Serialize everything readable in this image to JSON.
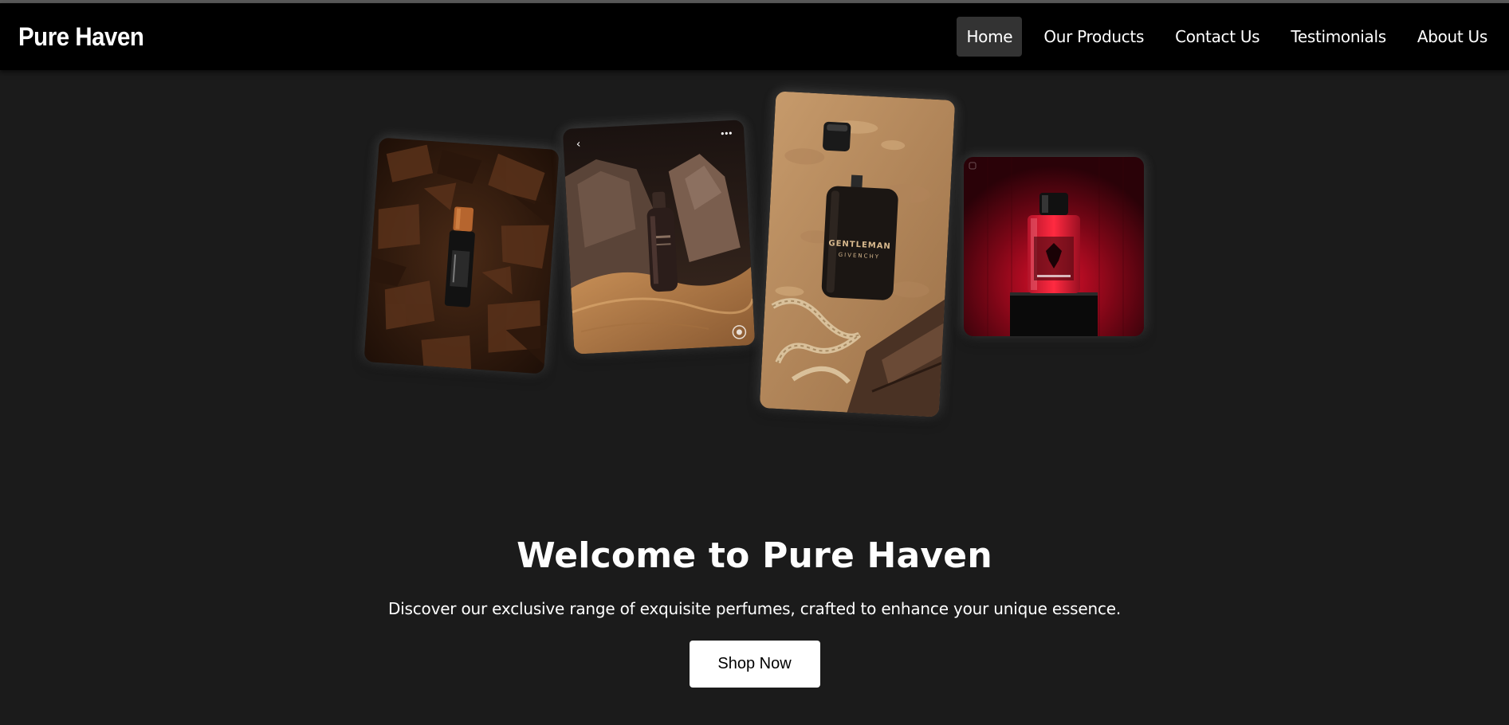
{
  "brand": {
    "name": "Pure Haven"
  },
  "nav": {
    "items": [
      {
        "label": "Home",
        "active": true
      },
      {
        "label": "Our Products"
      },
      {
        "label": "Contact Us"
      },
      {
        "label": "Testimonials"
      },
      {
        "label": "About Us"
      }
    ]
  },
  "gallery": {
    "images": [
      {
        "subject": "oud-oil-bottle-on-agarwood-chips"
      },
      {
        "subject": "dark-perfume-bottle-on-sand-and-rocks"
      },
      {
        "subject": "gentleman-givenchy-bottle-on-sand",
        "label_line1": "GENTLEMAN",
        "label_line2": "GIVENCHY"
      },
      {
        "subject": "red-perfume-bottle-on-black-pedestal"
      }
    ]
  },
  "hero": {
    "title": "Welcome to Pure Haven",
    "subtitle": "Discover our exclusive range of exquisite perfumes, crafted to enhance your unique essence.",
    "cta_label": "Shop Now"
  },
  "colors": {
    "background": "#1b1b1b",
    "header": "#000000",
    "active_nav": "#333333",
    "button": "#ffffff",
    "text": "#ffffff"
  }
}
